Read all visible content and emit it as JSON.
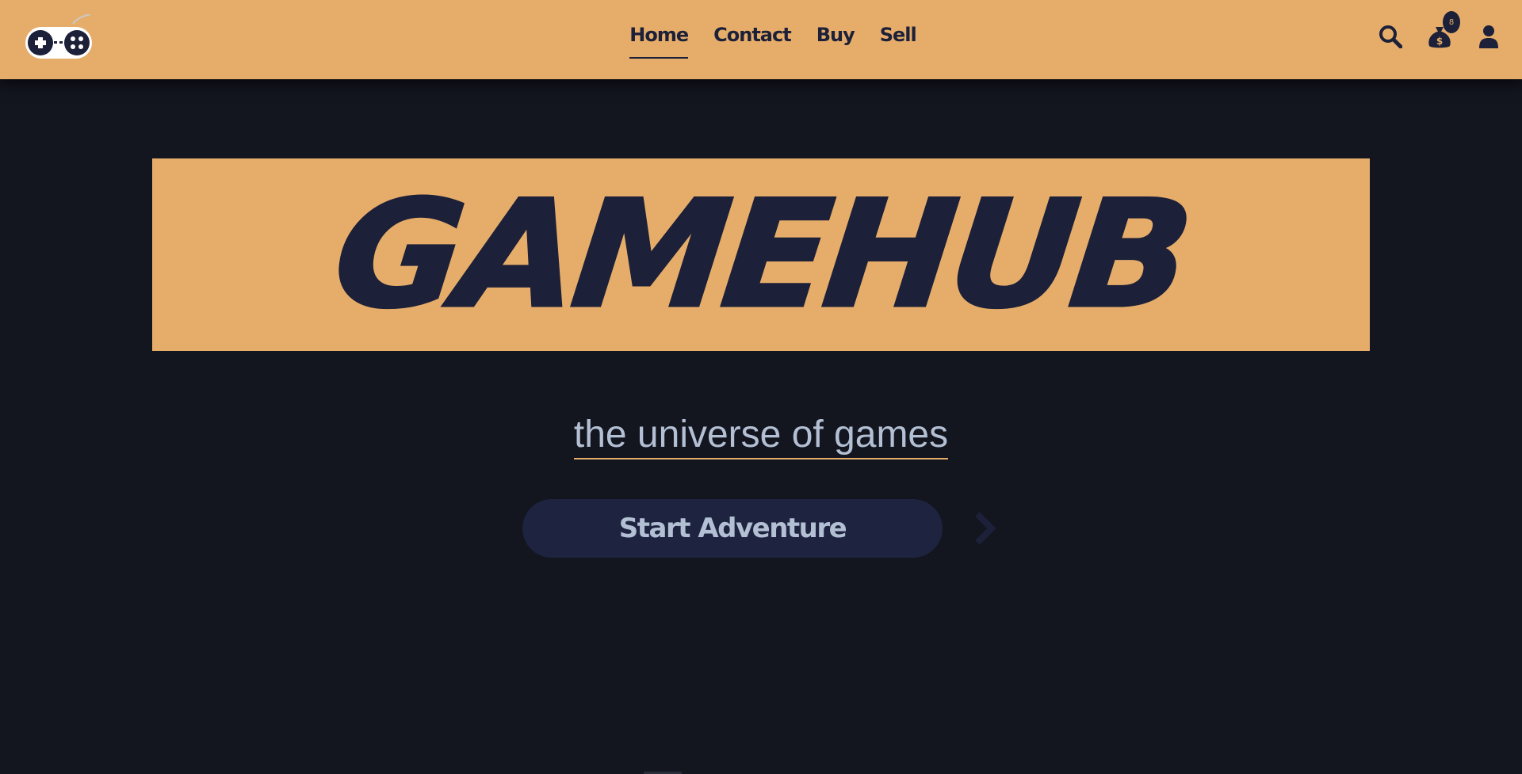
{
  "header": {
    "logo_icon": "gamepad-icon",
    "nav": [
      {
        "label": "Home",
        "active": true
      },
      {
        "label": "Contact",
        "active": false
      },
      {
        "label": "Buy",
        "active": false
      },
      {
        "label": "Sell",
        "active": false
      }
    ],
    "icons": {
      "search": "search-icon",
      "cart": "money-bag-icon",
      "account": "user-icon"
    },
    "cart_count": "8"
  },
  "hero": {
    "title": "GAMEHUB",
    "tagline": "the universe of games",
    "cta_label": "Start Adventure",
    "cta_icon": "chevron-right-icon"
  },
  "colors": {
    "accent": "#e6ad6a",
    "background": "#13151f",
    "dark_navy": "#1c2038",
    "button_bg": "#1e2340",
    "text_light": "#b3c0d4"
  }
}
